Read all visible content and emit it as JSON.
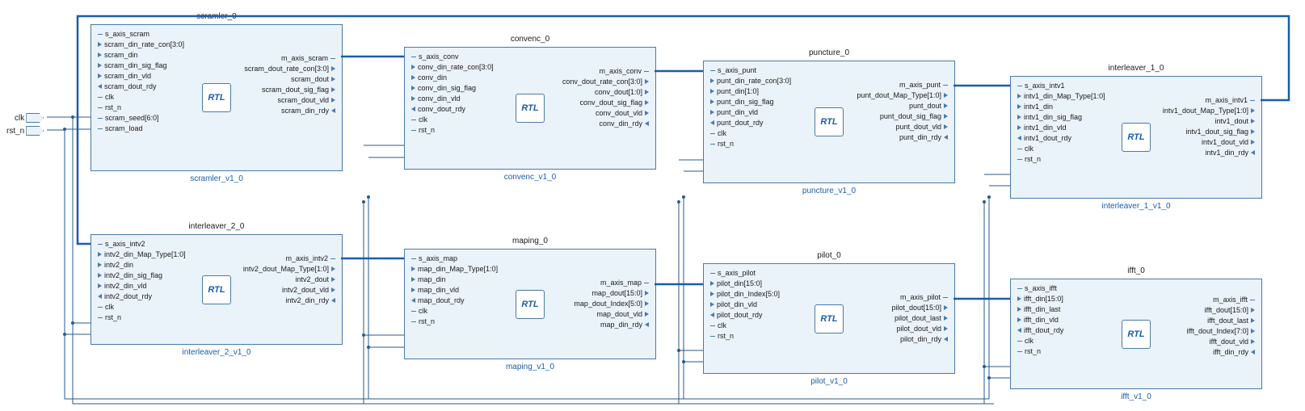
{
  "external_ports": {
    "clk": "clk",
    "rst_n": "rst_n"
  },
  "blocks": {
    "scrambler": {
      "title": "scramler_0",
      "footer": "scramler_v1_0",
      "left": [
        "s_axis_scram",
        "scram_din_rate_con[3:0]",
        "scram_din",
        "scram_din_sig_flag",
        "scram_din_vld",
        "scram_dout_rdy",
        "clk",
        "rst_n",
        "scram_seed[6:0]",
        "scram_load"
      ],
      "right": [
        "m_axis_scram",
        "scram_dout_rate_con[3:0]",
        "scram_dout",
        "scram_dout_sig_flag",
        "scram_dout_vld",
        "scram_din_rdy"
      ]
    },
    "convenc": {
      "title": "convenc_0",
      "footer": "convenc_v1_0",
      "left": [
        "s_axis_conv",
        "conv_din_rate_con[3:0]",
        "conv_din",
        "conv_din_sig_flag",
        "conv_din_vld",
        "conv_dout_rdy",
        "clk",
        "rst_n"
      ],
      "right": [
        "m_axis_conv",
        "conv_dout_rate_con[3:0]",
        "conv_dout[1:0]",
        "conv_dout_sig_flag",
        "conv_dout_vld",
        "conv_din_rdy"
      ]
    },
    "puncture": {
      "title": "puncture_0",
      "footer": "puncture_v1_0",
      "left": [
        "s_axis_punt",
        "punt_din_rate_con[3:0]",
        "punt_din[1:0]",
        "punt_din_sig_flag",
        "punt_din_vld",
        "punt_dout_rdy",
        "clk",
        "rst_n"
      ],
      "right": [
        "m_axis_punt",
        "punt_dout_Map_Type[1:0]",
        "punt_dout",
        "punt_dout_sig_flag",
        "punt_dout_vld",
        "punt_din_rdy"
      ]
    },
    "interleaver1": {
      "title": "interleaver_1_0",
      "footer": "interleaver_1_v1_0",
      "left": [
        "s_axis_intv1",
        "intv1_din_Map_Type[1:0]",
        "intv1_din",
        "intv1_din_sig_flag",
        "intv1_din_vld",
        "intv1_dout_rdy",
        "clk",
        "rst_n"
      ],
      "right": [
        "m_axis_intv1",
        "intv1_dout_Map_Type[1:0]",
        "intv1_dout",
        "intv1_dout_sig_flag",
        "intv1_dout_vld",
        "intv1_din_rdy"
      ]
    },
    "interleaver2": {
      "title": "interleaver_2_0",
      "footer": "interleaver_2_v1_0",
      "left": [
        "s_axis_intv2",
        "intv2_din_Map_Type[1:0]",
        "intv2_din",
        "intv2_din_sig_flag",
        "intv2_din_vld",
        "intv2_dout_rdy",
        "clk",
        "rst_n"
      ],
      "right": [
        "m_axis_intv2",
        "intv2_dout_Map_Type[1:0]",
        "intv2_dout",
        "intv2_dout_vld",
        "intv2_din_rdy"
      ]
    },
    "maping": {
      "title": "maping_0",
      "footer": "maping_v1_0",
      "left": [
        "s_axis_map",
        "map_din_Map_Type[1:0]",
        "map_din",
        "map_din_vld",
        "map_dout_rdy",
        "clk",
        "rst_n"
      ],
      "right": [
        "m_axis_map",
        "map_dout[15:0]",
        "map_dout_Index[5:0]",
        "map_dout_vld",
        "map_din_rdy"
      ]
    },
    "pilot": {
      "title": "pilot_0",
      "footer": "pilot_v1_0",
      "left": [
        "s_axis_pilot",
        "pilot_din[15:0]",
        "pilot_din_Index[5:0]",
        "pilot_din_vld",
        "pilot_dout_rdy",
        "clk",
        "rst_n"
      ],
      "right": [
        "m_axis_pilot",
        "pilot_dout[15:0]",
        "pilot_dout_last",
        "pilot_dout_vld",
        "pilot_din_rdy"
      ]
    },
    "ifft": {
      "title": "ifft_0",
      "footer": "ifft_v1_0",
      "left": [
        "s_axis_ifft",
        "ifft_din[15:0]",
        "ifft_din_last",
        "ifft_din_vld",
        "ifft_dout_rdy",
        "clk",
        "rst_n"
      ],
      "right": [
        "m_axis_ifft",
        "ifft_dout[15:0]",
        "ifft_dout_last",
        "ifft_dout_Index[7:0]",
        "ifft_dout_vld",
        "ifft_din_rdy"
      ]
    }
  },
  "rtl_label": "RTL"
}
